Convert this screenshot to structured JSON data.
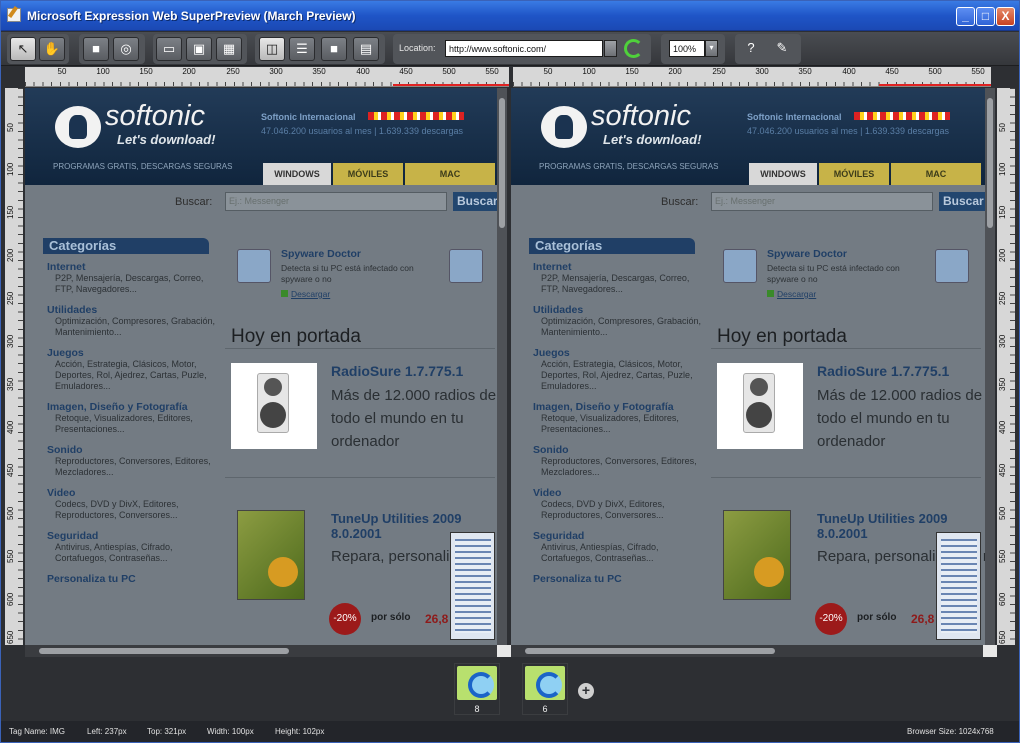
{
  "window": {
    "title": "Microsoft Expression Web SuperPreview (March Preview)",
    "minimize": "_",
    "maximize": "□",
    "close": "X"
  },
  "toolbar": {
    "tools": [
      {
        "name": "select-tool-icon",
        "glyph": "↖"
      },
      {
        "name": "pan-tool-icon",
        "glyph": "✋"
      },
      {
        "name": "dom-highlight-icon",
        "glyph": "■"
      },
      {
        "name": "ruler-tool-icon",
        "glyph": "◎"
      },
      {
        "name": "horizontal-layout-icon",
        "glyph": "▭"
      },
      {
        "name": "single-view-icon",
        "glyph": "▣"
      },
      {
        "name": "grid-view-icon",
        "glyph": "▦"
      },
      {
        "name": "side-by-side-icon",
        "glyph": "◫"
      },
      {
        "name": "stacked-icon",
        "glyph": "☰"
      },
      {
        "name": "overlay-icon",
        "glyph": "■"
      },
      {
        "name": "onion-skin-icon",
        "glyph": "▤"
      },
      {
        "name": "help-icon",
        "glyph": "?"
      },
      {
        "name": "feedback-icon",
        "glyph": "✎"
      }
    ],
    "location_label": "Location:",
    "location_value": "http://www.softonic.com/",
    "zoom_value": "100%",
    "zoom_arrow": "▾"
  },
  "ruler": {
    "ticks": [
      "50",
      "100",
      "150",
      "200",
      "250",
      "300",
      "350",
      "400",
      "450",
      "500",
      "550"
    ],
    "vticks": [
      "50",
      "100",
      "150",
      "200",
      "250",
      "300",
      "350",
      "400",
      "450",
      "500",
      "550",
      "600",
      "650"
    ]
  },
  "page": {
    "logo": "softonic",
    "tagline": "Let's download!",
    "intl": "Softonic Internacional",
    "stats": "47.046.200 usuarios al mes  |  1.639.339 descargas",
    "programs": "PROGRAMAS GRATIS, DESCARGAS SEGURAS",
    "tabs": [
      "WINDOWS",
      "MÓVILES",
      "MAC"
    ],
    "search_label": "Buscar:",
    "search_placeholder": "Ej.: Messenger",
    "search_button": "Buscar",
    "categories_title": "Categorías",
    "categories": [
      {
        "title": "Internet",
        "desc": "P2P, Mensajería, Descargas, Correo, FTP, Navegadores..."
      },
      {
        "title": "Utilidades",
        "desc": "Optimización, Compresores, Grabación, Mantenimiento..."
      },
      {
        "title": "Juegos",
        "desc": "Acción, Estrategia, Clásicos, Motor, Deportes, Rol, Ajedrez, Cartas, Puzle, Emuladores..."
      },
      {
        "title": "Imagen, Diseño y Fotografía",
        "desc": "Retoque, Visualizadores, Editores, Presentaciones..."
      },
      {
        "title": "Sonido",
        "desc": "Reproductores, Conversores, Editores, Mezcladores..."
      },
      {
        "title": "Video",
        "desc": "Codecs, DVD y DivX, Editores, Reproductores, Conversores..."
      },
      {
        "title": "Seguridad",
        "desc": "Antivirus, Antiespías, Cifrado, Cortafuegos, Contraseñas..."
      },
      {
        "title": "Personaliza tu PC",
        "desc": ""
      }
    ],
    "spyware_title": "Spyware Doctor",
    "spyware_desc": "Detecta si tu PC está infectado con spyware o no",
    "spyware_link": "Descargar",
    "hoy": "Hoy en portada",
    "radio_title": "RadioSure 1.7.775.1",
    "radio_desc": "Más de 12.000 radios de todo el mundo en tu ordenador",
    "tune_title": "TuneUp Utilities 2009 8.0.2001",
    "tune_desc": "Repara, personaliza y el rendimiento de",
    "discount": "-20%",
    "por_solo": "por sólo",
    "price": "26,8"
  },
  "baselines": [
    {
      "version": "8"
    },
    {
      "version": "6"
    }
  ],
  "add_baseline": "+",
  "status": {
    "tag": "Tag Name: IMG",
    "left": "Left: 237px",
    "top": "Top: 321px",
    "width": "Width: 100px",
    "height": "Height: 102px",
    "browser_size": "Browser Size: 1024x768"
  }
}
